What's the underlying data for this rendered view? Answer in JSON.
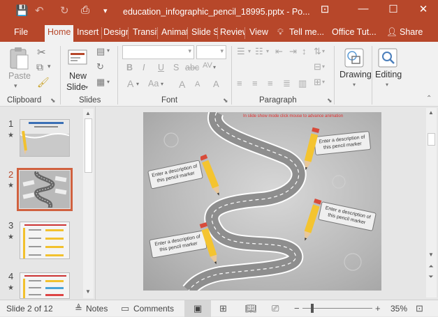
{
  "window": {
    "title": "education_infographic_pencil_18995.pptx - Po...",
    "buttons": {
      "ribbon_display": "⊡",
      "minimize": "—",
      "maximize": "☐",
      "close": "✕"
    }
  },
  "quick_access": {
    "save": "💾",
    "undo": "↶",
    "redo": "↻",
    "present": "⎙",
    "customize": "▾"
  },
  "tabs": {
    "file": "File",
    "home": "Home",
    "insert": "Insert",
    "design": "Design",
    "transitions": "Transitions",
    "animations": "Animations",
    "slideshow": "Slide Show",
    "review": "Review",
    "view": "View",
    "tellme": "Tell me...",
    "office_tut": "Office Tut...",
    "share": "Share"
  },
  "ribbon": {
    "clipboard": {
      "paste": "Paste",
      "label": "Clipboard"
    },
    "slides": {
      "new_slide_1": "New",
      "new_slide_2": "Slide",
      "label": "Slides"
    },
    "font": {
      "label": "Font",
      "bold": "B",
      "italic": "I",
      "underline": "U",
      "strike": "S",
      "shadow": "abc",
      "spacing": "AV",
      "font_color": "A",
      "change_case": "Aa",
      "grow": "A",
      "shrink": "A",
      "clear": "A"
    },
    "paragraph": {
      "label": "Paragraph"
    },
    "drawing": {
      "label": "Drawing"
    },
    "editing": {
      "label": "Editing"
    }
  },
  "thumbnails": [
    {
      "number": "1",
      "star": "★"
    },
    {
      "number": "2",
      "star": "★"
    },
    {
      "number": "3",
      "star": "★"
    },
    {
      "number": "4",
      "star": "★"
    }
  ],
  "slide": {
    "hint": "In slide show mode click mouse to advance animation",
    "callouts": [
      "Enter a description of this pencil marker",
      "Enter a description of this pencil marker",
      "Enter a description of this pencil marker",
      "Enter a description of this pencil marker"
    ]
  },
  "status": {
    "slide_of": "Slide 2 of 12",
    "notes": "Notes",
    "comments": "Comments",
    "zoom": "35%"
  }
}
